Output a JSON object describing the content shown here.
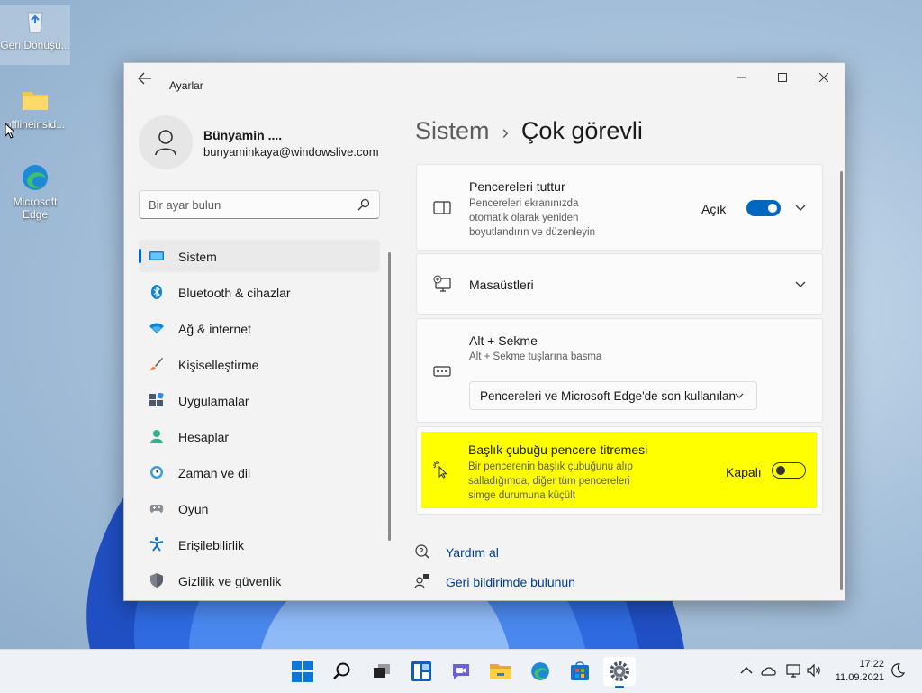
{
  "desktop": {
    "icons": [
      {
        "label": "Geri Dönüşü...",
        "icon": "recycle-bin-icon"
      },
      {
        "label": "offlineinsid...",
        "icon": "folder-icon"
      },
      {
        "label": "Microsoft Edge",
        "icon": "edge-icon"
      }
    ]
  },
  "window": {
    "title": "Ayarlar",
    "controls": [
      "minimize",
      "maximize",
      "close"
    ]
  },
  "profile": {
    "name": "Bünyamin ....",
    "email": "bunyaminkaya@windowslive.com"
  },
  "search": {
    "placeholder": "Bir ayar bulun"
  },
  "nav": {
    "items": [
      {
        "label": "Sistem",
        "icon": "system-icon",
        "active": true
      },
      {
        "label": "Bluetooth & cihazlar",
        "icon": "bluetooth-icon"
      },
      {
        "label": "Ağ & internet",
        "icon": "wifi-icon"
      },
      {
        "label": "Kişiselleştirme",
        "icon": "brush-icon"
      },
      {
        "label": "Uygulamalar",
        "icon": "apps-icon"
      },
      {
        "label": "Hesaplar",
        "icon": "account-icon"
      },
      {
        "label": "Zaman ve dil",
        "icon": "clock-globe-icon"
      },
      {
        "label": "Oyun",
        "icon": "gamepad-icon"
      },
      {
        "label": "Erişilebilirlik",
        "icon": "accessibility-icon"
      },
      {
        "label": "Gizlilik ve güvenlik",
        "icon": "shield-icon"
      }
    ]
  },
  "breadcrumb": {
    "parent": "Sistem",
    "current": "Çok görevli"
  },
  "cards": {
    "snap": {
      "title": "Pencereleri tuttur",
      "desc1": "Pencereleri ekranınızda",
      "desc2": "otomatik olarak yeniden",
      "desc3": "boyutlandırın ve düzenleyin",
      "state": "Açık"
    },
    "desktops": {
      "title": "Masaüstleri"
    },
    "alttab": {
      "title": "Alt + Sekme",
      "desc": "Alt + Sekme tuşlarına basma",
      "selected": "Pencereleri ve Microsoft Edge'de son kullanılan"
    },
    "shake": {
      "title": "Başlık çubuğu pencere titremesi",
      "desc1": "Bir pencerenin başlık çubuğunu alıp",
      "desc2": "salladığımda, diğer tüm pencereleri",
      "desc3": "simge durumuna küçült",
      "state": "Kapalı"
    }
  },
  "links": {
    "help": "Yardım al",
    "feedback": "Geri bildirimde bulunun"
  },
  "taskbar": {
    "apps": [
      "start-icon",
      "search-icon",
      "task-view-icon",
      "widgets-icon",
      "chat-icon",
      "file-explorer-icon",
      "edge-icon",
      "store-icon",
      "settings-icon"
    ],
    "time": "17:22",
    "date": "11.09.2021"
  },
  "colors": {
    "accent": "#0067c0",
    "highlight": "#ffff00"
  }
}
